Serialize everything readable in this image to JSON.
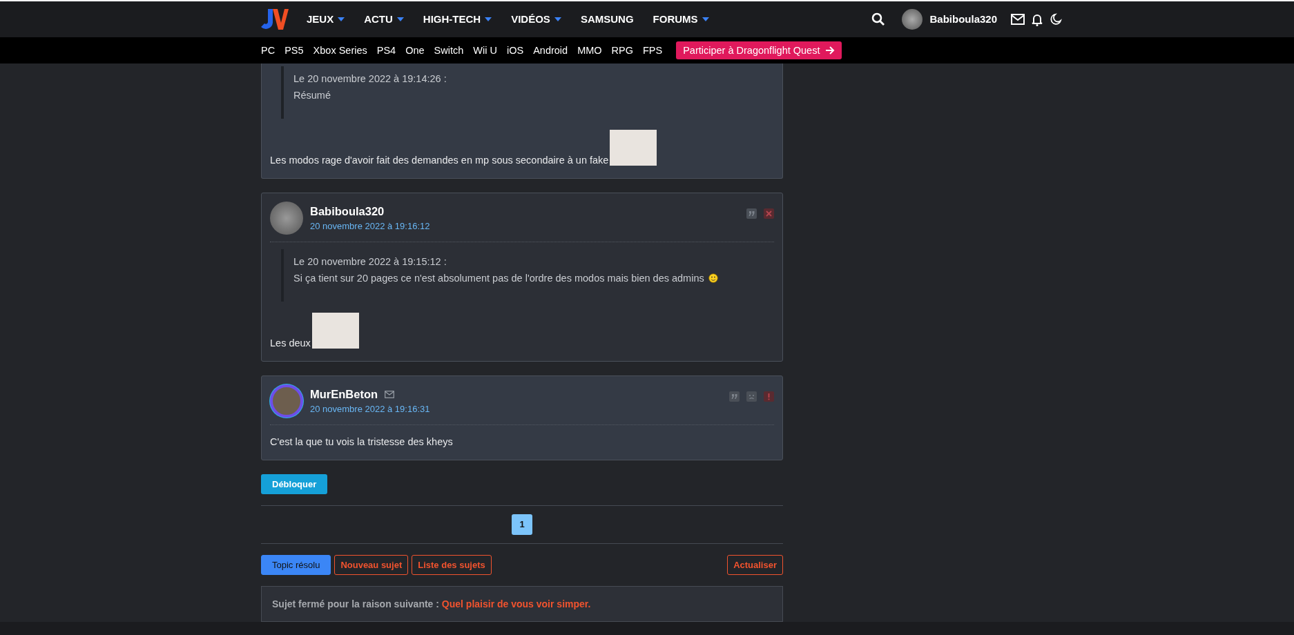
{
  "header": {
    "nav": [
      {
        "label": "JEUX",
        "has_menu": true
      },
      {
        "label": "ACTU",
        "has_menu": true
      },
      {
        "label": "HIGH-TECH",
        "has_menu": true
      },
      {
        "label": "VIDÉOS",
        "has_menu": true
      },
      {
        "label": "SAMSUNG",
        "has_menu": false
      },
      {
        "label": "FORUMS",
        "has_menu": true
      }
    ],
    "username": "Babiboula320"
  },
  "subnav": {
    "items": [
      "PC",
      "PS5",
      "Xbox Series",
      "PS4",
      "One",
      "Switch",
      "Wii U",
      "iOS",
      "Android",
      "MMO",
      "RPG",
      "FPS"
    ],
    "promo": "Participer à Dragonflight Quest"
  },
  "posts": [
    {
      "quote": {
        "meta": "Le 20 novembre 2022 à 19:14:26 :",
        "text": "Résumé"
      },
      "body": "Les modos rage d'avoir fait des demandes en mp sous secondaire à un fake",
      "image": true,
      "own": false
    },
    {
      "author": "Babiboula320",
      "date": "20 novembre 2022 à 19:16:12",
      "mp_icon": false,
      "ring": false,
      "own": true,
      "actions": [
        {
          "kind": "quote"
        },
        {
          "kind": "delete"
        }
      ],
      "quote": {
        "meta": "Le 20 novembre 2022 à 19:15:12 :",
        "text": "Si ça tient sur 20 pages ce n'est absolument pas de l'ordre des modos mais bien des admins",
        "smiley": true
      },
      "body": "Les deux",
      "image": true
    },
    {
      "author": "MurEnBeton",
      "date": "20 novembre 2022 à 19:16:31",
      "mp_icon": true,
      "ring": true,
      "own": false,
      "actions": [
        {
          "kind": "quote"
        },
        {
          "kind": "sad"
        },
        {
          "kind": "report"
        }
      ],
      "body": "C'est la que tu vois la tristesse des kheys",
      "image": false
    }
  ],
  "unblock_button": "Débloquer",
  "pages": [
    {
      "label": "1",
      "selected": true
    }
  ],
  "buttons": [
    {
      "label": "Topic résolu",
      "kind": "primary"
    },
    {
      "label": "Nouveau sujet",
      "kind": "outline"
    },
    {
      "label": "Liste des sujets",
      "kind": "outline"
    }
  ],
  "refresh_button": "Actualiser",
  "notice": {
    "label": "Sujet fermé pour la raison suivante :",
    "reason": "Quel plaisir de vous voir simper."
  }
}
